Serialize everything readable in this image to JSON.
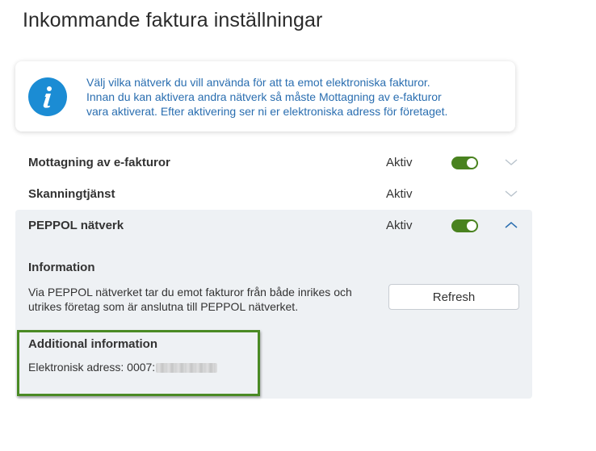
{
  "page": {
    "title": "Inkommande faktura inställningar"
  },
  "info_banner": {
    "icon": "info-icon",
    "lines": [
      "Välj vilka nätverk du vill använda för att ta emot elektroniska fakturor.",
      "Innan du kan aktivera andra nätverk så måste Mottagning av e-fakturor",
      "vara aktiverat. Efter aktivering ser ni er elektroniska adress för företaget."
    ]
  },
  "networks": [
    {
      "label": "Mottagning av e-fakturor",
      "status": "Aktiv",
      "toggle_on": true,
      "expanded": false
    },
    {
      "label": "Skanningtjänst",
      "status": "Aktiv",
      "toggle_on": false,
      "expanded": false
    },
    {
      "label": "PEPPOL nätverk",
      "status": "Aktiv",
      "toggle_on": true,
      "expanded": true
    }
  ],
  "peppol_details": {
    "info_heading": "Information",
    "info_lines": [
      "Via PEPPOL nätverket tar du emot fakturor från både inrikes och",
      "utrikes företag som är anslutna till PEPPOL nätverket."
    ],
    "refresh_label": "Refresh",
    "additional_heading": "Additional information",
    "address_label": "Elektronisk adress: 0007:"
  },
  "colors": {
    "accent_blue": "#1b8cd4",
    "info_text": "#2a6eb0",
    "toggle_green": "#49821f",
    "highlight_border": "#4a8a24",
    "panel_bg": "#eef1f4"
  }
}
